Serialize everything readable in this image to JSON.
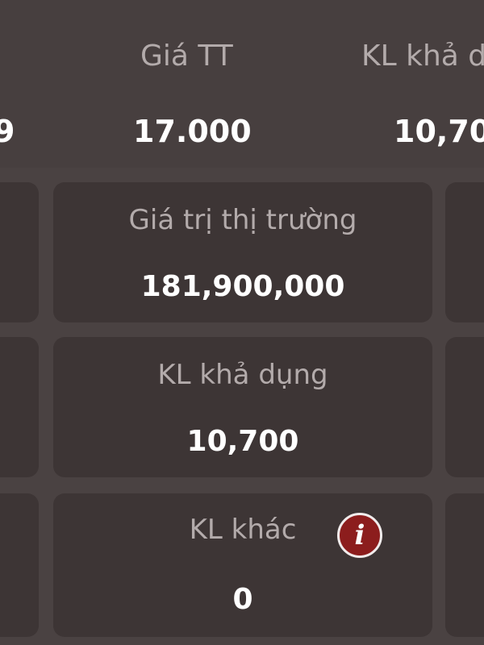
{
  "header": {
    "left_value_fragment": "9",
    "market_price_label": "Giá TT",
    "market_price_value": "17.000",
    "available_qty_label": "KL khả d",
    "available_qty_value": "10,70"
  },
  "cards": {
    "market_value": {
      "label": "Giá trị thị trường",
      "value": "181,900,000"
    },
    "available_qty": {
      "label": "KL khả dụng",
      "value": "10,700"
    },
    "other_qty": {
      "label": "KL khác",
      "value": "0",
      "info_icon": "i"
    }
  },
  "colors": {
    "background": "#4a4242",
    "card": "#3d3535",
    "label": "#b3abab",
    "value": "#ffffff",
    "info_icon": "#8c1d1d"
  }
}
